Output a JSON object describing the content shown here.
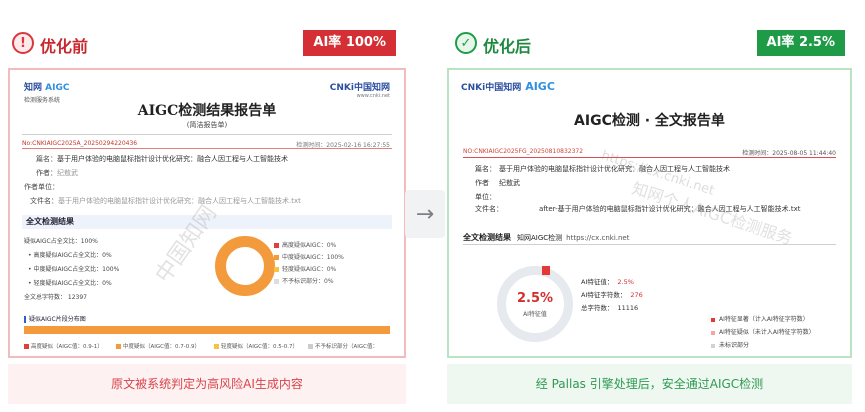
{
  "before": {
    "header": {
      "icon": "!",
      "title": "优化前",
      "badge": "AI率 100%"
    },
    "report": {
      "logo_brand": "知网",
      "logo_aigc": "AIGC",
      "logo_sub": "检测服务系统",
      "cnki_logo": "CNKi中国知网",
      "cnki_url": "www.cnki.net",
      "title": "AIGC检测结果报告单",
      "subtitle": "(简洁报告单)",
      "report_no": "No:CNKIAIGC2025A_20250294220436",
      "detect_time": "检测时间：2025-02-16 16:27:55",
      "fields": [
        {
          "label": "篇名：",
          "value": "基于用户体验的电脑鼠标指针设计优化研究：融合人因工程与人工智能技术",
          "muted": false
        },
        {
          "label": "作者：",
          "value": "纪敖武",
          "muted": true
        },
        {
          "label": "作者单位：",
          "value": "",
          "muted": true
        },
        {
          "label": "文件名：",
          "value": "基于用户体验的电脑鼠标指针设计优化研究：融合人因工程与人工智能技术.txt",
          "muted": true
        }
      ],
      "section_title": "全文检测结果",
      "stats": [
        "疑似AIGC占全文比：100%",
        "• 高度疑似AIGC占全文比：0%",
        "• 中度疑似AIGC占全文比：100%",
        "• 轻度疑似AIGC占全文比：0%",
        "全文总字符数：  12397"
      ],
      "legend": [
        {
          "label": "高度疑似AIGC：0%",
          "color": "#e0403a"
        },
        {
          "label": "中度疑似AIGC：100%",
          "color": "#f39a3c"
        },
        {
          "label": "轻度疑似AIGC：0%",
          "color": "#f5c242"
        },
        {
          "label": "不予标识部分：0%",
          "color": "#dddddd"
        }
      ],
      "distribution_title": "疑似AIGC片段分布图",
      "bottom_legend": [
        {
          "label": "高度疑似（AIGC值：0.9-1）",
          "color": "#e0403a"
        },
        {
          "label": "中度疑似（AIGC值：0.7-0.9）",
          "color": "#f39a3c"
        },
        {
          "label": "轻度疑似（AIGC值：0.5-0.7）",
          "color": "#f5c242"
        },
        {
          "label": "不予标识部分（AIGC值：",
          "color": "#cccccc"
        }
      ],
      "watermark": "中国知网"
    },
    "footer": "原文被系统判定为高风险AI生成内容"
  },
  "arrow_icon": "→",
  "after": {
    "header": {
      "icon": "✓",
      "title": "优化后",
      "badge": "AI率 2.5%"
    },
    "report": {
      "logo_brand": "CNKi中国知网",
      "logo_aigc": "AIGC",
      "title": "AIGC检测 · 全文报告单",
      "report_no": "NO:CNKIAIGC2025FG_20250810832372",
      "detect_time": "检测时间：2025-08-05 11:44:40",
      "fields": [
        {
          "label": "篇名：",
          "value": "基于用户体验的电脑鼠标指针设计优化研究：融合人因工程与人工智能技术"
        },
        {
          "label": "作者",
          "value": "纪敖武"
        },
        {
          "label": "单位：",
          "value": ""
        },
        {
          "label": "文件名：",
          "value": "after-基于用户体验的电脑鼠标指针设计优化研究：融合人因工程与人工智能技术.txt"
        }
      ],
      "section_title": "全文检测结果",
      "section_service": "知网AIGC检测",
      "section_url": "https://cx.cnki.net",
      "donut_value": "2.5%",
      "donut_label": "AI特征值",
      "donut_fraction": 0.025,
      "stats": [
        {
          "label": "AI特征值：",
          "value": "2.5%",
          "red": true
        },
        {
          "label": "AI特征字符数：",
          "value": "276",
          "red": true
        },
        {
          "label": "总字符数：",
          "value": "11116",
          "red": false
        }
      ],
      "legend": [
        {
          "label": "AI特征显著（计入AI特征字符数）",
          "color": "#e53935"
        },
        {
          "label": "AI特征疑似（未计入AI特征字符数）",
          "color": "#f2a6a6"
        },
        {
          "label": "未标识部分",
          "color": "#cfd3d8"
        }
      ],
      "watermark_1": "https://cx.cnki.net",
      "watermark_2": "知网个人AIGC检测服务"
    },
    "footer": "经 Pallas 引擎处理后，安全通过AIGC检测"
  }
}
